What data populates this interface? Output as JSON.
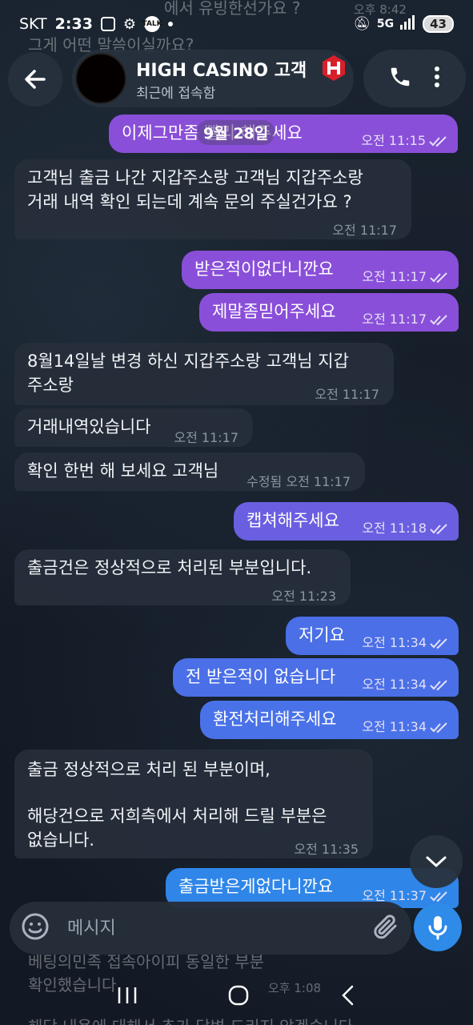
{
  "status_bar": {
    "carrier": "SKT",
    "time": "2:33",
    "talk_badge": "TALK",
    "network": "5G",
    "battery": "43"
  },
  "header": {
    "title": "HIGH CASINO 고객",
    "subtitle": "최근에 접속함"
  },
  "date_chip": "9월 28일",
  "ghost_top": {
    "line1": "에서 유빙한선가요 ?",
    "line1_time": "오후 8:42",
    "line2": "그게 어떤 말씀이실까요?"
  },
  "messages": [
    {
      "dir": "out",
      "color": "#8a4fd9",
      "text": "이제그만좀 빨리 해주세요",
      "time": "오전 11:15",
      "status": "read"
    },
    {
      "dir": "in",
      "lines": [
        "고객님 출금 나간 지갑주소랑 고객님 지갑주소랑",
        "거래 내역 확인 되는데 계속 문의 주실건가요 ?"
      ],
      "time": "오전 11:17"
    },
    {
      "dir": "out",
      "color": "#8a4fd9",
      "text": "받은적이없다니깐요",
      "time": "오전 11:17",
      "status": "read"
    },
    {
      "dir": "out",
      "color": "#8a4fd9",
      "text": "제말좀믿어주세요",
      "time": "오전 11:17",
      "status": "read"
    },
    {
      "dir": "in",
      "lines": [
        "8월14일날 변경 하신 지갑주소랑 고객님 지갑",
        "주소랑"
      ],
      "time": "오전 11:17"
    },
    {
      "dir": "in",
      "text": "거래내역있습니다",
      "time": "오전 11:17"
    },
    {
      "dir": "in",
      "text": "확인 한번 해 보세요 고객님",
      "edited": "수정됨",
      "time": "오전 11:17"
    },
    {
      "dir": "out",
      "color": "#6a5fe0",
      "text": "캡쳐해주세요",
      "time": "오전 11:18",
      "status": "read"
    },
    {
      "dir": "in",
      "text": "출금건은 정상적으로 처리된 부분입니다.",
      "time": "오전 11:23"
    },
    {
      "dir": "out",
      "color": "#4a6fe6",
      "text": "저기요",
      "time": "오전 11:34",
      "status": "read"
    },
    {
      "dir": "out",
      "color": "#4a6fe6",
      "text": "전 받은적이 없습니다",
      "time": "오전 11:34",
      "status": "read"
    },
    {
      "dir": "out",
      "color": "#4a72e8",
      "text": "환전처리해주세요",
      "time": "오전 11:34",
      "status": "read"
    },
    {
      "dir": "in",
      "lines": [
        "출금 정상적으로 처리 된 부분이며,",
        "",
        "해당건으로 저희측에서 처리해 드릴 부분은",
        "없습니다."
      ],
      "time": "오전 11:35"
    },
    {
      "dir": "out",
      "color": "#2f86e8",
      "text": "출금받은게없다니깐요",
      "time": "오전 11:37",
      "status": "read"
    }
  ],
  "ghost_bottom": {
    "line1": "베팅의민족 접속아이피 동일한 부분",
    "line2": "확인했습니다",
    "time": "오후 1:08",
    "line3": "해당 내용에 대해서 추가 답변 드리지 않겠습니다"
  },
  "input": {
    "placeholder": "메시지"
  },
  "icons": {
    "back": "back-arrow-icon",
    "call": "phone-icon",
    "more": "more-vert-icon",
    "emoji": "emoji-icon",
    "attach": "paperclip-icon",
    "mic": "microphone-icon",
    "scroll": "chevron-down-icon"
  }
}
